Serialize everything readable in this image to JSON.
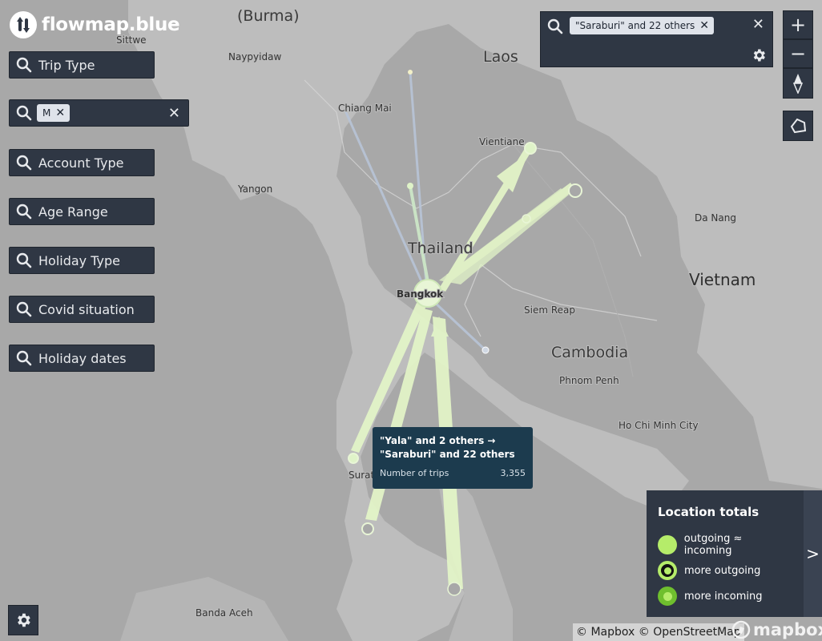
{
  "app": {
    "name": "flowmap.blue"
  },
  "filters": [
    {
      "label": "Trip Type"
    },
    {
      "label": "Account Type"
    },
    {
      "label": "Age Range"
    },
    {
      "label": "Holiday Type"
    },
    {
      "label": "Covid situation"
    },
    {
      "label": "Holiday dates"
    }
  ],
  "active_filter": {
    "tag": "M"
  },
  "location_search": {
    "tag": "\"Saraburi\" and 22 others"
  },
  "zoom": {
    "in": "+",
    "out": "−"
  },
  "places": {
    "burma": "(Burma)",
    "sittwe": "Sittwe",
    "naypyidaw": "Naypyidaw",
    "laos": "Laos",
    "chiang_mai": "Chiang Mai",
    "vientiane": "Vientiane",
    "yangon": "Yangon",
    "da_nang": "Da Nang",
    "thailand": "Thailand",
    "bangkok": "Bangkok",
    "vietnam": "Vietnam",
    "siem_reap": "Siem Reap",
    "cambodia": "Cambodia",
    "phnom_penh": "Phnom Penh",
    "ho_chi_minh": "Ho Chi Minh City",
    "surat": "Surat",
    "banda_aceh": "Banda Aceh"
  },
  "tooltip": {
    "title": "\"Yala\" and 2 others → \"Saraburi\" and 22 others",
    "metric_label": "Number of trips",
    "metric_value": "3,355"
  },
  "legend": {
    "title": "Location totals",
    "items": [
      {
        "label": "outgoing ≈ incoming"
      },
      {
        "label": "more outgoing"
      },
      {
        "label": "more incoming"
      }
    ],
    "collapse_label": ">"
  },
  "attribution": {
    "text": "© Mapbox © OpenStreetMap",
    "logo": "mapbox"
  },
  "colors": {
    "flow": "#e4f6c8",
    "flow_edge": "#c9ef9c",
    "panel": "#2f3744",
    "tooltip": "#1c3b4e",
    "legend_green": "#b5ec6a"
  }
}
